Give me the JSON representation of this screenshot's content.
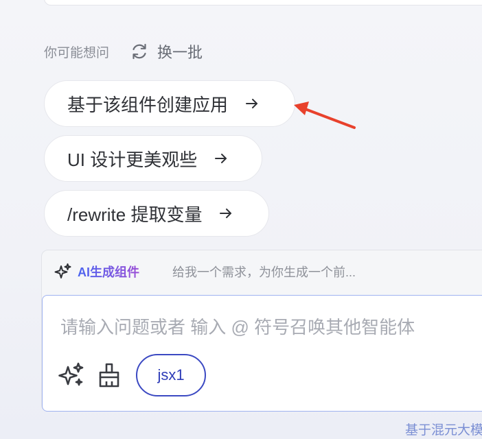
{
  "suggestions": {
    "title": "你可能想问",
    "refresh_label": "换一批",
    "items": [
      {
        "label": "基于该组件创建应用"
      },
      {
        "label": "UI 设计更美观些"
      },
      {
        "label": "/rewrite 提取变量"
      }
    ]
  },
  "annotation": {
    "arrow_color": "#e8412c"
  },
  "composer": {
    "agent_name": "AI生成组件",
    "agent_description": "给我一个需求，为你生成一个前...",
    "input_placeholder": "请输入问题或者 输入 @ 符号召唤其他智能体",
    "tag_label": "jsx1"
  },
  "footer": {
    "note": "基于混元大模"
  },
  "colors": {
    "accent": "#3b49c2",
    "focus_border": "#9fb2f0"
  }
}
